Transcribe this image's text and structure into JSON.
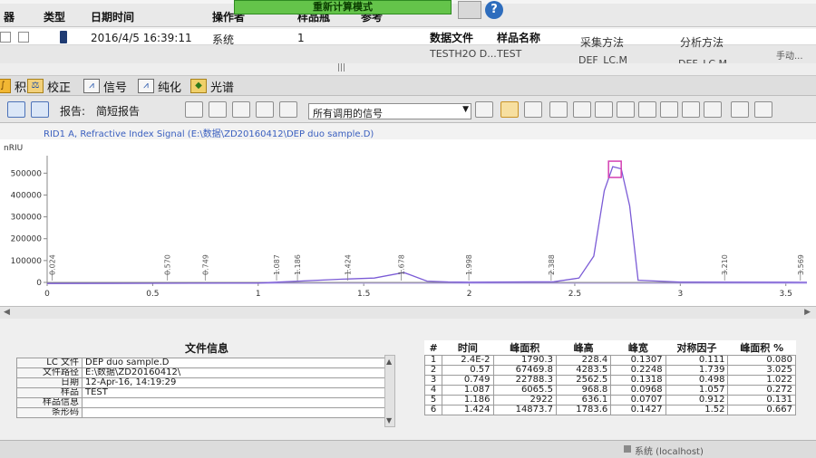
{
  "window": {
    "mode_label": "重新计算模式",
    "help_icon": "help-icon"
  },
  "grid": {
    "header": [
      "器",
      "类型",
      "日期时间",
      "操作者",
      "样品瓶",
      "参考"
    ],
    "row1": {
      "datetime": "2016/4/5 16:39:11",
      "operator": "系统",
      "vial": "1"
    },
    "header2": [
      "数据文件",
      "样品名称",
      "采集方法",
      "分析方法",
      "手动..."
    ],
    "row2": {
      "datafile": "TESTH2O D...",
      "sample": "TEST",
      "acq_method": "DEF_LC.M",
      "ana_method": "DEF_LC.M"
    },
    "grip": "|||"
  },
  "tabs": [
    {
      "label": "积分",
      "icon": "integrate-icon"
    },
    {
      "label": "校正",
      "icon": "calibrate-icon"
    },
    {
      "label": "信号",
      "icon": "signal-icon"
    },
    {
      "label": "纯化",
      "icon": "purify-icon"
    },
    {
      "label": "光谱",
      "icon": "spectrum-icon"
    }
  ],
  "toolbar": {
    "report_label": "报告:",
    "report_type": "简短报告",
    "signal_select": "所有调用的信号"
  },
  "colors": {
    "trace": "#7b5bd6",
    "peak_marker": "#d43fb2",
    "active_tab": "#f2b733",
    "mode_bar": "#64c44a"
  },
  "chart_data": {
    "type": "line",
    "signal_label": "RID1 A, Refractive Index Signal (E:\\数据\\ZD20160412\\DEP  duo sample.D)",
    "ylabel": "nRIU",
    "xlim": [
      0,
      3.6
    ],
    "ylim": [
      0,
      580000
    ],
    "yticks": [
      0,
      100000,
      200000,
      300000,
      400000,
      500000
    ],
    "xticks": [
      "0",
      "0.5",
      "1",
      "1.5",
      "2",
      "2.5",
      "3",
      "3.5"
    ],
    "x": [
      0.0,
      0.5,
      1.0,
      1.4,
      1.55,
      1.69,
      1.72,
      1.8,
      1.9,
      2.0,
      2.4,
      2.52,
      2.59,
      2.64,
      2.68,
      2.72,
      2.76,
      2.8,
      3.0,
      3.5,
      3.6
    ],
    "values": [
      -5000,
      -4000,
      -3000,
      15000,
      20000,
      45000,
      35000,
      6000,
      2000,
      1000,
      3000,
      20000,
      120000,
      420000,
      530000,
      520000,
      350000,
      10000,
      1500,
      800,
      600
    ],
    "peak_labels": [
      {
        "text": "0.024",
        "x": 0.024
      },
      {
        "text": "0.570",
        "x": 0.57
      },
      {
        "text": "0.749",
        "x": 0.749
      },
      {
        "text": "1.087",
        "x": 1.087
      },
      {
        "text": "1.186",
        "x": 1.186
      },
      {
        "text": "1.424",
        "x": 1.424
      },
      {
        "text": "1.678",
        "x": 1.678
      },
      {
        "text": "1.998",
        "x": 1.998
      },
      {
        "text": "2.388",
        "x": 2.388
      },
      {
        "text": "3.210",
        "x": 3.21
      },
      {
        "text": "3.569",
        "x": 3.569
      }
    ]
  },
  "file_info": {
    "title": "文件信息",
    "rows": [
      {
        "key": "LC 文件",
        "value": "DEP  duo sample.D"
      },
      {
        "key": "文件路径",
        "value": "E:\\数据\\ZD20160412\\"
      },
      {
        "key": "日期",
        "value": "12-Apr-16, 14:19:29"
      },
      {
        "key": "样品",
        "value": "TEST"
      },
      {
        "key": "样品信息",
        "value": ""
      },
      {
        "key": "条形码",
        "value": ""
      }
    ]
  },
  "peaks": {
    "columns": [
      "#",
      "时间",
      "峰面积",
      "峰高",
      "峰宽",
      "对称因子",
      "峰面积 %"
    ],
    "rows": [
      [
        "1",
        "2.4E-2",
        "1790.3",
        "228.4",
        "0.1307",
        "0.111",
        "0.080"
      ],
      [
        "2",
        "0.57",
        "67469.8",
        "4283.5",
        "0.2248",
        "1.739",
        "3.025"
      ],
      [
        "3",
        "0.749",
        "22788.3",
        "2562.5",
        "0.1318",
        "0.498",
        "1.022"
      ],
      [
        "4",
        "1.087",
        "6065.5",
        "968.8",
        "0.0968",
        "1.057",
        "0.272"
      ],
      [
        "5",
        "1.186",
        "2922",
        "636.1",
        "0.0707",
        "0.912",
        "0.131"
      ],
      [
        "6",
        "1.424",
        "14873.7",
        "1783.6",
        "0.1427",
        "1.52",
        "0.667"
      ]
    ]
  },
  "status": {
    "text": "系统 (localhost)"
  }
}
